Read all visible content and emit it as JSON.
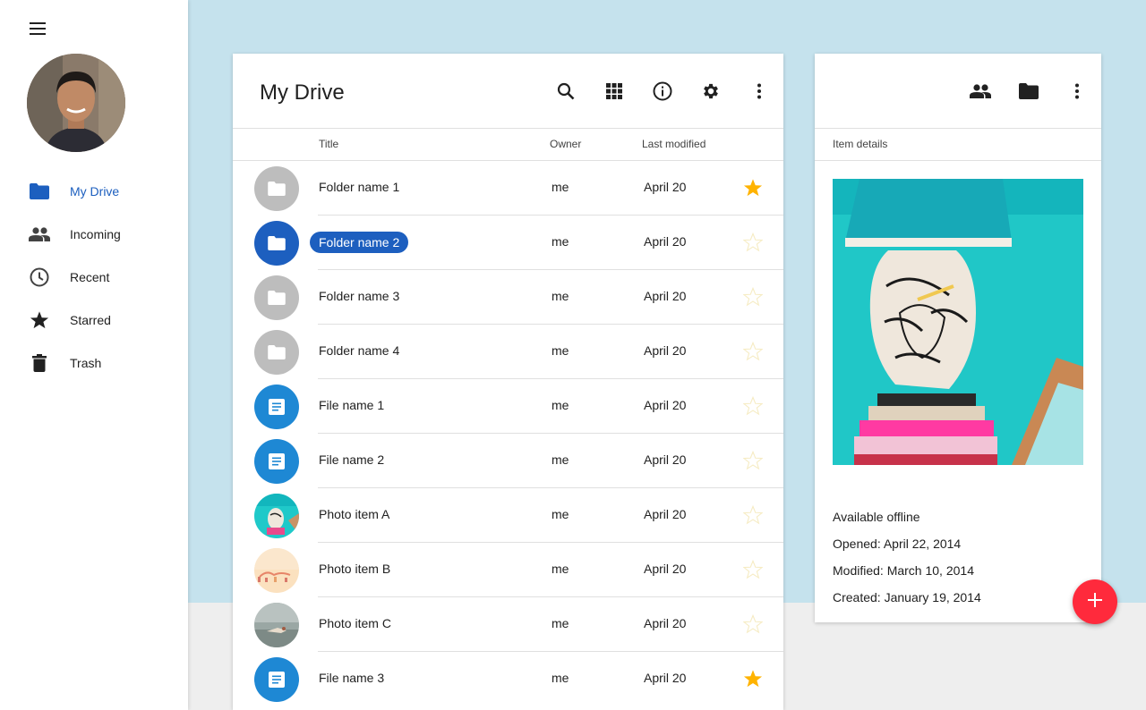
{
  "sidebar": {
    "items": [
      {
        "label": "My Drive",
        "icon": "folder-icon",
        "active": true
      },
      {
        "label": "Incoming",
        "icon": "people-icon"
      },
      {
        "label": "Recent",
        "icon": "clock-icon"
      },
      {
        "label": "Starred",
        "icon": "star-icon"
      },
      {
        "label": "Trash",
        "icon": "trash-icon"
      }
    ]
  },
  "main": {
    "title": "My Drive",
    "toolbar": [
      "search-icon",
      "grid-view-icon",
      "info-icon",
      "settings-icon",
      "more-vert-icon"
    ],
    "columns": {
      "title": "Title",
      "owner": "Owner",
      "modified": "Last modified"
    },
    "rows": [
      {
        "name": "Folder name 1",
        "owner": "me",
        "modified": "April 20",
        "type": "folder",
        "starred": true
      },
      {
        "name": "Folder name 2",
        "owner": "me",
        "modified": "April 20",
        "type": "folder",
        "selected": true,
        "starred": false
      },
      {
        "name": "Folder name 3",
        "owner": "me",
        "modified": "April 20",
        "type": "folder",
        "starred": false
      },
      {
        "name": "Folder name 4",
        "owner": "me",
        "modified": "April 20",
        "type": "folder",
        "starred": false
      },
      {
        "name": "File name 1",
        "owner": "me",
        "modified": "April 20",
        "type": "file",
        "starred": false
      },
      {
        "name": "File name 2",
        "owner": "me",
        "modified": "April 20",
        "type": "file",
        "starred": false
      },
      {
        "name": "Photo item A",
        "owner": "me",
        "modified": "April 20",
        "type": "photo-a",
        "starred": false
      },
      {
        "name": "Photo item B",
        "owner": "me",
        "modified": "April 20",
        "type": "photo-b",
        "starred": false
      },
      {
        "name": "Photo item C",
        "owner": "me",
        "modified": "April 20",
        "type": "photo-c",
        "starred": false
      },
      {
        "name": "File name 3",
        "owner": "me",
        "modified": "April 20",
        "type": "file",
        "starred": true
      }
    ]
  },
  "details": {
    "toolbar": [
      "people-icon",
      "folder-icon",
      "more-vert-icon"
    ],
    "section_label": "Item details",
    "offline": "Available offline",
    "opened": "Opened: April 22, 2014",
    "modified": "Modified: March 10, 2014",
    "created": "Created: January 19, 2014"
  },
  "colors": {
    "accent": "#1d5fbf",
    "file_blue": "#1e88d4",
    "folder_grey": "#bdbdbd",
    "star_gold": "#ffb300",
    "fab_red": "#ff2a3c",
    "background": "#c5e2ed"
  }
}
